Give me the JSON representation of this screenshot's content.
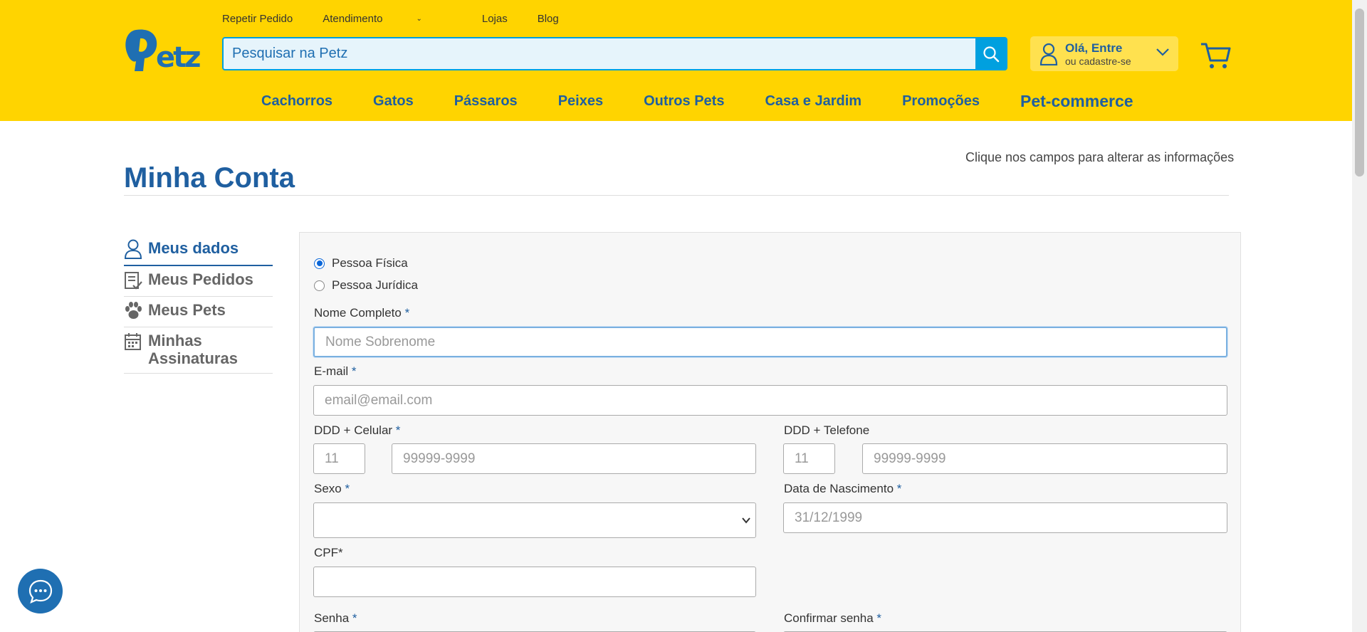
{
  "header": {
    "logo_text": "Petz",
    "top_links": [
      {
        "label": "Repetir Pedido"
      },
      {
        "label": "Atendimento"
      },
      {
        "label": "Lojas"
      },
      {
        "label": "Blog"
      }
    ],
    "search": {
      "placeholder": "Pesquisar na Petz",
      "icon": "search-icon"
    },
    "account": {
      "greeting": "Olá, Entre",
      "sub": "ou cadastre-se",
      "icon": "user-icon"
    },
    "cart_icon": "cart-icon",
    "nav": [
      {
        "label": "Cachorros"
      },
      {
        "label": "Gatos"
      },
      {
        "label": "Pássaros"
      },
      {
        "label": "Peixes"
      },
      {
        "label": "Outros Pets"
      },
      {
        "label": "Casa e Jardim"
      },
      {
        "label": "Promoções"
      },
      {
        "label": "Pet-commerce"
      }
    ],
    "colors": {
      "background": "#ffd400",
      "brand_blue": "#1f5fa0",
      "search_accent": "#00a0df"
    }
  },
  "page": {
    "title": "Minha Conta",
    "hint": "Clique nos campos para alterar as informações"
  },
  "sidebar": {
    "items": [
      {
        "label": "Meus dados",
        "icon": "user-icon",
        "active": true
      },
      {
        "label": "Meus Pedidos",
        "icon": "orders-icon",
        "active": false
      },
      {
        "label": "Meus Pets",
        "icon": "paw-icon",
        "active": false
      },
      {
        "label": "Minhas Assinaturas",
        "icon": "calendar-icon",
        "active": false
      }
    ]
  },
  "form": {
    "person_type": {
      "options": [
        "Pessoa Física",
        "Pessoa Jurídica"
      ],
      "selected": "Pessoa Física"
    },
    "required_mark": "*",
    "full_name": {
      "label": "Nome Completo",
      "placeholder": "Nome Sobrenome",
      "value": ""
    },
    "email": {
      "label": "E-mail",
      "placeholder": "email@email.com",
      "value": ""
    },
    "mobile": {
      "label": "DDD + Celular",
      "ddd_placeholder": "11",
      "number_placeholder": "99999-9999"
    },
    "phone": {
      "label": "DDD + Telefone",
      "ddd_placeholder": "11",
      "number_placeholder": "99999-9999"
    },
    "gender": {
      "label": "Sexo",
      "value": ""
    },
    "birthdate": {
      "label": "Data de Nascimento",
      "placeholder": "31/12/1999"
    },
    "cpf": {
      "label": "CPF*",
      "value": ""
    },
    "password": {
      "label": "Senha"
    },
    "confirm_password": {
      "label": "Confirmar senha"
    }
  },
  "chat": {
    "icon": "chat-icon"
  }
}
